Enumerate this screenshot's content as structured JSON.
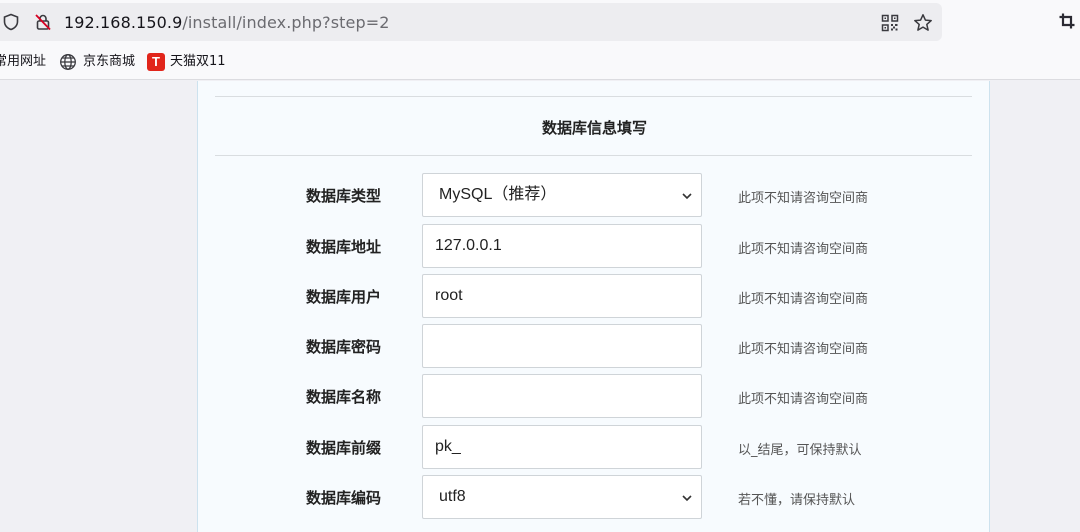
{
  "browser": {
    "url_host": "192.168.150.9",
    "url_path": "/install/index.php?step=2",
    "bookmarks": [
      {
        "label": "常用网址"
      },
      {
        "label": "京东商城"
      },
      {
        "label": "天猫双11",
        "badge": "T"
      }
    ],
    "colors": {
      "tmall_badge": "#e1251b"
    }
  },
  "form": {
    "title": "数据库信息填写",
    "rows": [
      {
        "label": "数据库类型",
        "value": "MySQL（推荐）",
        "hint": "此项不知请咨询空间商"
      },
      {
        "label": "数据库地址",
        "value": "127.0.0.1",
        "hint": "此项不知请咨询空间商"
      },
      {
        "label": "数据库用户",
        "value": "root",
        "hint": "此项不知请咨询空间商"
      },
      {
        "label": "数据库密码",
        "value": "",
        "hint": "此项不知请咨询空间商"
      },
      {
        "label": "数据库名称",
        "value": "",
        "hint": "此项不知请咨询空间商"
      },
      {
        "label": "数据库前缀",
        "value": "pk_",
        "hint": "以_结尾，可保持默认"
      },
      {
        "label": "数据库编码",
        "value": "utf8",
        "hint": "若不懂，请保持默认"
      }
    ]
  }
}
